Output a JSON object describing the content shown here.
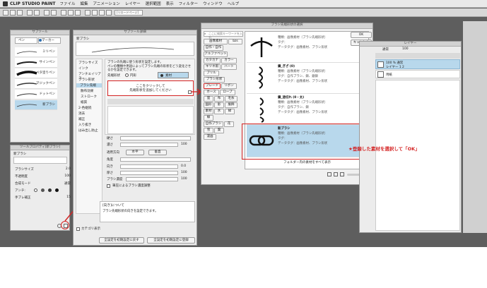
{
  "app": {
    "name": "CLIP STUDIO PAINT"
  },
  "menu": [
    "ファイル",
    "編集",
    "アニメーション",
    "レイヤー",
    "選択範囲",
    "表示",
    "フィルター",
    "ウィンドウ",
    "ヘルプ"
  ],
  "toolbar": {
    "field_text": "[リロードページ]"
  },
  "subtool_panel": {
    "title": "サブツール",
    "tabs": [
      "ペン",
      "マーカー"
    ],
    "items": [
      "ミリペン",
      "サインペン",
      "ベタ塗りペン",
      "マジックペン",
      "ドットペン",
      "新ブラシ"
    ]
  },
  "tool_property": {
    "title": "ツールプロパティ[新ブラシ]",
    "name": "新ブラシ",
    "rows": [
      {
        "label": "ブラシサイズ",
        "value": "2.0"
      },
      {
        "label": "不透明度",
        "value": "100"
      },
      {
        "label": "合成モード",
        "value": "通常"
      },
      {
        "label": "アンチ:",
        "value": ""
      },
      {
        "label": "手ブレ補正",
        "value": "15"
      }
    ]
  },
  "subtool_detail": {
    "title": "サブツール詳細",
    "name": "新ブラシ",
    "categories": [
      "ブラシサイズ",
      "インク",
      "アンチエイリアス",
      "ブラシ形状",
      "ブラシ先端",
      "散布効果",
      "ストローク",
      "紙質",
      "2-色継続",
      "消去",
      "補正",
      "入り抜き",
      "はみ出し防止"
    ],
    "desc1": "ブラシの先端に使う形状を設定します。",
    "desc2": "ペンの種類や用途によってブラシ先端の形状をどう変化させるかを設定できます。",
    "tip_shape_label": "先端形状",
    "radio_circle": "円形",
    "radio_material": "素材",
    "add_line1": "ここをクリックして",
    "add_line2": "先端形状を追加してください",
    "params": [
      {
        "label": "硬さ",
        "value": ""
      },
      {
        "label": "濃さ",
        "value": "100"
      },
      {
        "label": "適用方向",
        "value": ""
      },
      {
        "label": "角度",
        "value": ""
      },
      {
        "label": "向き",
        "value": "0.0"
      },
      {
        "label": "厚さ",
        "value": "100"
      },
      {
        "label": "ブラシ濃度",
        "value": "100"
      },
      {
        "label": "筆圧によるブラシ濃度調整",
        "value": ""
      }
    ],
    "direction_h": "水平",
    "direction_v": "垂直",
    "help_title": "[向き]について",
    "help_text": "ブラシ先端形状の向きを設定できます。",
    "show_category": "カテゴリ表示",
    "reset_all": "全設定を初期設定に戻す",
    "register_all": "全設定を初期設定に登録"
  },
  "dialog": {
    "title": "ブラシ先端形状の選択",
    "search_placeholder": "ここに検索キーワードを入力",
    "tags": [
      "画像素材",
      "bzs",
      "自作・自作",
      "アルファベット",
      "カタカナ",
      "カラー",
      "キツネ雨",
      "ハート",
      "ブリル",
      "ブラシ形状",
      "ブレード",
      "リボン",
      "ホース",
      "ロープ",
      "雲",
      "布",
      "毛糸",
      "図形",
      "影",
      "服飾",
      "素材",
      "水",
      "緑",
      "線",
      "自作ブラシ",
      "花",
      "雪",
      "葉",
      "漫画"
    ],
    "materials": [
      {
        "name": "",
        "lines": [
          "種類：画像素材（ブラシ先端形状）",
          "タグ：",
          "データタグ：画像素材、ブラシ形状"
        ]
      },
      {
        "name": "鎖_ぎざ (0)",
        "lines": [
          "種類：画像素材（ブラシ先端形状）",
          "タグ：自作ブラシ、鎖、銀鎖",
          "データタグ：画像素材、ブラシ形状"
        ]
      },
      {
        "name": "鎖_途切れ (0・太)",
        "lines": [
          "種類：画像素材（ブラシ先端形状）",
          "タグ：自作ブラシ、鎖",
          "データタグ：画像素材、ブラシ形状"
        ]
      },
      {
        "name": "新ブラシ",
        "lines": [
          "種類：画像素材（ブラシ先端形状）",
          "タグ：",
          "データタグ：画像素材、ブラシ形状"
        ]
      }
    ],
    "footer": "フォルダー内の素材をすべて表示",
    "ok": "OK",
    "cancel": "キャンセル"
  },
  "layer_panel": {
    "title": "レイヤー",
    "blend": "通常",
    "opacity": "100",
    "rows": [
      {
        "name": "100 % 通常",
        "sub": "レイヤー 1 2"
      },
      {
        "name": "用紙",
        "sub": ""
      }
    ]
  },
  "annotation": "★登録した素材を選択して「OK」",
  "colors": {
    "accent_red": "#d42323",
    "selection_blue": "#b8d8ec",
    "panel_bg": "#ececec"
  }
}
